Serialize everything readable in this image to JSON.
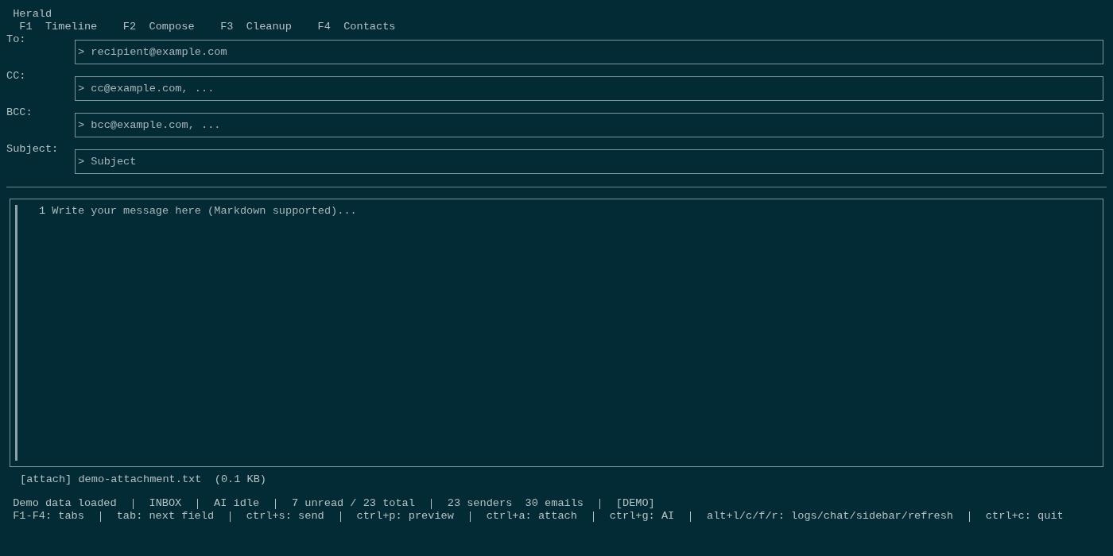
{
  "app": {
    "title": "Herald"
  },
  "tabs": [
    {
      "key": "F1",
      "label": "Timeline"
    },
    {
      "key": "F2",
      "label": "Compose"
    },
    {
      "key": "F3",
      "label": "Cleanup"
    },
    {
      "key": "F4",
      "label": "Contacts"
    }
  ],
  "fields": [
    {
      "label": "To:",
      "placeholder": "> recipient@example.com"
    },
    {
      "label": "CC:",
      "placeholder": "> cc@example.com, ..."
    },
    {
      "label": "BCC:",
      "placeholder": "> bcc@example.com, ..."
    },
    {
      "label": "Subject:",
      "placeholder": "> Subject"
    }
  ],
  "editor": {
    "line_number": "1",
    "placeholder": "Write your message here (Markdown supported)..."
  },
  "attachments": [
    {
      "tag": "[attach]",
      "filename": "demo-attachment.txt",
      "size": "(0.1 KB)"
    }
  ],
  "status_bar": {
    "items": [
      "Demo data loaded",
      "INBOX",
      "AI idle",
      "7 unread / 23 total",
      "23 senders  30 emails",
      "[DEMO]"
    ],
    "hints": [
      "F1-F4: tabs",
      "tab: next field",
      "ctrl+s: send",
      "ctrl+p: preview",
      "ctrl+a: attach",
      "ctrl+g: AI",
      "alt+l/c/f/r: logs/chat/sidebar/refresh",
      "ctrl+c: quit"
    ]
  }
}
